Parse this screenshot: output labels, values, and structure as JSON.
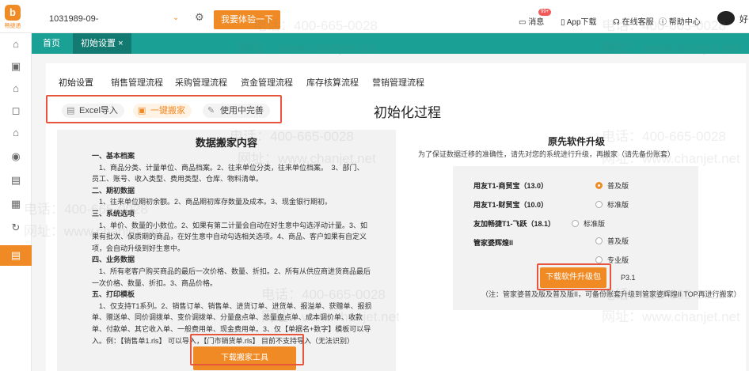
{
  "header": {
    "logo_mark": "b",
    "logo_text": "畅捷通",
    "account": "1031989-09-",
    "try_button": "我要体验一下",
    "messages": "消息",
    "messages_badge": "99+",
    "app_download": "App下载",
    "online_service": "在线客服",
    "help_center": "帮助中心",
    "user": "好"
  },
  "tabs": [
    {
      "label": "首页"
    },
    {
      "label": "初始设置",
      "close": "×"
    }
  ],
  "subnav": [
    "初始设置",
    "销售管理流程",
    "采购管理流程",
    "资金管理流程",
    "库存核算流程",
    "营销管理流程"
  ],
  "steps": [
    {
      "label": "Excel导入",
      "icon": "excel-icon"
    },
    {
      "label": "一键搬家",
      "icon": "move-icon"
    },
    {
      "label": "使用中完善",
      "icon": "edit-icon"
    }
  ],
  "main_title": "初始化过程",
  "migration": {
    "title": "数据搬家内容",
    "lines": [
      {
        "h": true,
        "text": "一、基本档案"
      },
      {
        "h": false,
        "text": "　1、商品分类、计量单位、商品档案。2、往来单位分类，往来单位档案。　3、部门、"
      },
      {
        "h": false,
        "text": "员工、账号、收入类型、费用类型、仓库、物料清单。"
      },
      {
        "h": true,
        "text": "二、期初数据"
      },
      {
        "h": false,
        "text": "　1、往来单位期初余额。2、商品期初库存数量及成本。3、现金银行期初。"
      },
      {
        "h": true,
        "text": "三、系统选项"
      },
      {
        "h": false,
        "text": "　1、单价、数量的小数位。2、如果有第二计量会自动在好生意中勾选浮动计量。3、如"
      },
      {
        "h": false,
        "text": "果有批次、保质期的商品，在好生意中自动勾选相关选项。4、商品、客户如果有自定义"
      },
      {
        "h": false,
        "text": "项，会自动升级到好生意中。"
      },
      {
        "h": true,
        "text": "四、业务数据"
      },
      {
        "h": false,
        "text": "　1、所有老客户购买商品的最后一次价格、数量、折扣。2、所有从供应商进货商品最后"
      },
      {
        "h": false,
        "text": "一次价格、数量、折扣。3、商品价格。"
      },
      {
        "h": true,
        "text": "五、打印模板"
      },
      {
        "h": false,
        "text": "　1、仅支持T1系列。2、销售订单、销售单、进货订单、进货单、报溢单、获赠单、报损"
      },
      {
        "h": false,
        "text": "单、赠送单、同价调拨单、变价调拨单、分量盘点单、总量盘点单、成本调价单、收款"
      },
      {
        "h": false,
        "text": "单、付款单、其它收入单、一般费用单、现金费用单。3、仅【单据名+数字】模板可以导"
      },
      {
        "h": false,
        "text": "入。例：【销售单1.rls】 可以导入，【门市销货单.rls】 目前不支持导入（无法识别）"
      }
    ],
    "download_button": "下载搬家工具"
  },
  "upgrade": {
    "title": "原先软件升级",
    "desc": "为了保证数据迁移的准确性，请先对您的系统进行升级，再搬家（请先备份账套）",
    "products": [
      {
        "name": "用友T1-商贸宝（13.0）"
      },
      {
        "name": "用友T1-财贸宝（10.0）"
      },
      {
        "name": "友加畅捷T1-飞跃（18.1）"
      },
      {
        "name": "管家婆辉煌II"
      }
    ],
    "options": [
      {
        "label": "普及版",
        "checked": true
      },
      {
        "label": "标准版",
        "checked": false
      },
      {
        "label": "标准版",
        "checked": false
      },
      {
        "label": "普及版",
        "checked": false
      },
      {
        "label": "专业版",
        "checked": false
      }
    ],
    "upgrade_button": "下载软件升级包",
    "version_suffix": "P3.1",
    "note": "（注：管家婆普及版及普及版II，可备份账套升级到管家婆辉煌II TOP再进行搬家）"
  },
  "watermark": {
    "phone": "电话：400-665-0028",
    "site": "网址：www.chanjet.net"
  }
}
